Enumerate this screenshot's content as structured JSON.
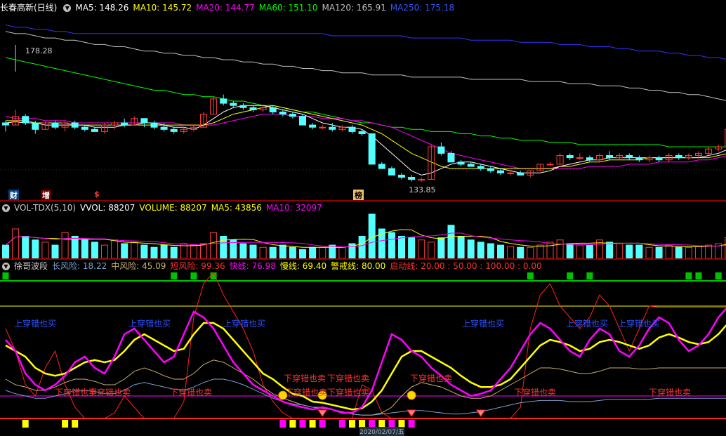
{
  "colors": {
    "bg": "#000000",
    "up": "#ff3c3c",
    "down": "#54ffff",
    "ma5": "#ffffff",
    "ma10": "#ffff00",
    "ma20": "#ff00ff",
    "ma60": "#00ff00",
    "ma120": "#c0c0c0",
    "ma250": "#3333ff"
  },
  "price_panel": {
    "title": "长春高新(日线)",
    "ma_labels": [
      "MA5: 148.26",
      "MA10: 145.72",
      "MA20: 144.77",
      "MA60: 151.10",
      "MA120: 165.91",
      "MA250: 175.18"
    ],
    "high_label": "178.28",
    "low_label": "133.85",
    "markers": [
      "财",
      "增",
      "$",
      "榜"
    ]
  },
  "vol_panel": {
    "title": "VOL-TDX(5,10)",
    "labels": [
      "VVOL: 88207",
      "VOLUME: 88207",
      "MA5: 43856",
      "MA10: 32097"
    ]
  },
  "wave_panel": {
    "title": "徐哥波段",
    "labels": [
      "长风险: 18.22",
      "中风险: 45.09",
      "短风险: 99.36",
      "快线: 76.98",
      "慢线: 69.40",
      "警戒线: 80.00",
      "启动线: 20.00 : 50.00 : 100.00 : 0.00"
    ],
    "buy_signal": "上穿错也买",
    "sell_signal": "下穿错也卖",
    "date_label": "2020/02/07/五"
  },
  "chart_data": {
    "type": "candlestick",
    "ohlc": [
      [
        140,
        141,
        136,
        139
      ],
      [
        139,
        146,
        139,
        143
      ],
      [
        143,
        144,
        139,
        140
      ],
      [
        140,
        141,
        135,
        137
      ],
      [
        137,
        141,
        137,
        140
      ],
      [
        140,
        141,
        137,
        138
      ],
      [
        138,
        141,
        136,
        140
      ],
      [
        140,
        141,
        137,
        138
      ],
      [
        138,
        139,
        136,
        137
      ],
      [
        137,
        138,
        136,
        136
      ],
      [
        136,
        140,
        135,
        139
      ],
      [
        139,
        141,
        137,
        140
      ],
      [
        140,
        142,
        138,
        139
      ],
      [
        139,
        143,
        139,
        142
      ],
      [
        142,
        142,
        138,
        140
      ],
      [
        140,
        141,
        137,
        138
      ],
      [
        138,
        140,
        136,
        137
      ],
      [
        137,
        138,
        135,
        136
      ],
      [
        136,
        138,
        135,
        137
      ],
      [
        137,
        139,
        136,
        138
      ],
      [
        138,
        145,
        138,
        144
      ],
      [
        144,
        152,
        144,
        151
      ],
      [
        151,
        153,
        148,
        149
      ],
      [
        149,
        150,
        147,
        148
      ],
      [
        148,
        149,
        146,
        147
      ],
      [
        147,
        148,
        145,
        146
      ],
      [
        146,
        148,
        145,
        147
      ],
      [
        147,
        148,
        144,
        145
      ],
      [
        145,
        146,
        143,
        144
      ],
      [
        144,
        145,
        142,
        143
      ],
      [
        143,
        144,
        139,
        139
      ],
      [
        139,
        140,
        137,
        138
      ],
      [
        138,
        139,
        137,
        138
      ],
      [
        138,
        140,
        136,
        137
      ],
      [
        137,
        139,
        136,
        138
      ],
      [
        138,
        139,
        135,
        136
      ],
      [
        136,
        137,
        134,
        135
      ],
      [
        135,
        134,
        121,
        121
      ],
      [
        121,
        122,
        119,
        119
      ],
      [
        119,
        120,
        116,
        116
      ],
      [
        116,
        117,
        114,
        115
      ],
      [
        115,
        116,
        113,
        114
      ],
      [
        114,
        115,
        113,
        114
      ],
      [
        114,
        130,
        114,
        129
      ],
      [
        129,
        131,
        125,
        126
      ],
      [
        126,
        127,
        122,
        122
      ],
      [
        122,
        123,
        120,
        121
      ],
      [
        121,
        122,
        120,
        120
      ],
      [
        120,
        121,
        118,
        119
      ],
      [
        119,
        120,
        117,
        118
      ],
      [
        118,
        119,
        116,
        117
      ],
      [
        117,
        118,
        116,
        117
      ],
      [
        117,
        118,
        116,
        116
      ],
      [
        116,
        118,
        115,
        118
      ],
      [
        118,
        121,
        118,
        121
      ],
      [
        121,
        122,
        120,
        121
      ],
      [
        121,
        126,
        121,
        125
      ],
      [
        125,
        126,
        123,
        124
      ],
      [
        124,
        126,
        123,
        124
      ],
      [
        124,
        125,
        122,
        123
      ],
      [
        123,
        126,
        122,
        125
      ],
      [
        125,
        127,
        123,
        124
      ],
      [
        124,
        126,
        123,
        125
      ],
      [
        125,
        126,
        123,
        124
      ],
      [
        124,
        125,
        122,
        123
      ],
      [
        123,
        125,
        122,
        124
      ],
      [
        124,
        125,
        122,
        123
      ],
      [
        123,
        126,
        122,
        125
      ],
      [
        125,
        126,
        123,
        124
      ],
      [
        124,
        126,
        123,
        125
      ],
      [
        125,
        127,
        124,
        126
      ],
      [
        126,
        129,
        125,
        128
      ],
      [
        128,
        130,
        127,
        129
      ],
      [
        129,
        138,
        129,
        137
      ]
    ],
    "ma5": [
      140,
      140.5,
      140,
      140,
      139,
      139,
      139,
      139,
      139,
      138,
      138,
      138,
      139,
      139,
      140,
      140,
      139,
      138,
      138,
      137,
      139,
      142,
      145,
      147,
      148,
      148,
      148,
      147,
      146,
      145,
      144,
      142,
      140,
      139,
      138,
      138,
      137,
      134,
      130,
      126,
      122,
      118,
      116,
      117,
      119,
      121,
      122,
      122,
      121,
      120,
      119,
      118,
      117,
      117,
      117,
      118,
      120,
      121,
      122,
      123,
      123,
      124,
      124,
      124,
      124,
      124,
      124,
      124,
      124,
      124,
      124,
      125,
      126,
      128
    ],
    "ma10": [
      141,
      141,
      141,
      140,
      140,
      140,
      140,
      139,
      139,
      139,
      139,
      139,
      139,
      139,
      139,
      139,
      139,
      139,
      139,
      139,
      139,
      140,
      142,
      144,
      145,
      146,
      147,
      148,
      147,
      146,
      145,
      144,
      143,
      142,
      141,
      140,
      139,
      137,
      135,
      132,
      129,
      126,
      124,
      122,
      120,
      119,
      119,
      119,
      119,
      119,
      119,
      119,
      119,
      119,
      119,
      119,
      120,
      120,
      121,
      122,
      122,
      123,
      123,
      123,
      123,
      124,
      124,
      124,
      124,
      124,
      124,
      124,
      125,
      126
    ],
    "ma20": [
      143,
      142,
      142,
      142,
      141,
      141,
      141,
      140,
      140,
      140,
      140,
      140,
      140,
      140,
      140,
      140,
      140,
      140,
      139,
      139,
      139,
      139,
      140,
      141,
      142,
      143,
      144,
      144,
      144,
      143,
      143,
      143,
      142,
      142,
      142,
      141,
      141,
      140,
      139,
      138,
      136,
      134,
      132,
      130,
      128,
      126,
      125,
      124,
      123,
      122,
      121,
      120,
      119,
      119,
      119,
      119,
      119,
      119,
      119,
      120,
      120,
      120,
      120,
      121,
      121,
      121,
      122,
      122,
      122,
      122,
      123,
      123,
      124,
      125
    ],
    "ma60": [
      170,
      169,
      168,
      167,
      166,
      165,
      164,
      163,
      162,
      161,
      160,
      159,
      158,
      157,
      156,
      155,
      155,
      154,
      153,
      153,
      152,
      152,
      151,
      150,
      150,
      149,
      148,
      148,
      147,
      146,
      145,
      145,
      144,
      143,
      142,
      141,
      140,
      140,
      139,
      138,
      138,
      137,
      137,
      136,
      136,
      136,
      135,
      135,
      134,
      134,
      133,
      133,
      132,
      132,
      132,
      131,
      131,
      131,
      130,
      130,
      130,
      130,
      130,
      130,
      130,
      130,
      130,
      129,
      129,
      129,
      129,
      129,
      129,
      129
    ],
    "ma120": [
      182,
      181,
      181,
      180,
      179,
      179,
      178,
      178,
      177,
      176,
      176,
      175,
      175,
      174,
      173,
      173,
      172,
      172,
      171,
      171,
      170,
      170,
      169,
      169,
      168,
      168,
      167,
      167,
      166,
      166,
      165,
      165,
      164,
      164,
      163,
      163,
      163,
      162,
      162,
      162,
      162,
      161,
      161,
      161,
      161,
      161,
      161,
      160,
      160,
      160,
      160,
      160,
      160,
      159,
      159,
      159,
      159,
      158,
      158,
      158,
      157,
      157,
      157,
      156,
      156,
      155,
      155,
      154,
      154,
      153,
      153,
      152,
      151,
      150
    ],
    "ma250": [
      185,
      184,
      184,
      183,
      183,
      182,
      182,
      181,
      181,
      181,
      181,
      181,
      181,
      181,
      181,
      181,
      181,
      181,
      181,
      181,
      181,
      181,
      181,
      181,
      181,
      181,
      181,
      181,
      181,
      181,
      181,
      181,
      181,
      180,
      180,
      180,
      180,
      180,
      180,
      180,
      180,
      179,
      179,
      179,
      179,
      179,
      179,
      178,
      178,
      178,
      178,
      178,
      177,
      177,
      177,
      177,
      176,
      176,
      176,
      175,
      175,
      175,
      174,
      174,
      173,
      173,
      173,
      172,
      172,
      171,
      171,
      170,
      170,
      169
    ],
    "volume": [
      18,
      40,
      30,
      25,
      22,
      18,
      35,
      30,
      25,
      22,
      18,
      25,
      20,
      22,
      18,
      15,
      18,
      15,
      20,
      18,
      20,
      35,
      30,
      25,
      20,
      18,
      15,
      15,
      18,
      15,
      12,
      15,
      15,
      18,
      15,
      20,
      30,
      60,
      40,
      35,
      30,
      28,
      25,
      22,
      28,
      45,
      30,
      25,
      22,
      20,
      18,
      16,
      15,
      15,
      18,
      22,
      25,
      20,
      18,
      18,
      25,
      22,
      20,
      18,
      18,
      15,
      15,
      18,
      15,
      15,
      16,
      18,
      20,
      28
    ]
  }
}
